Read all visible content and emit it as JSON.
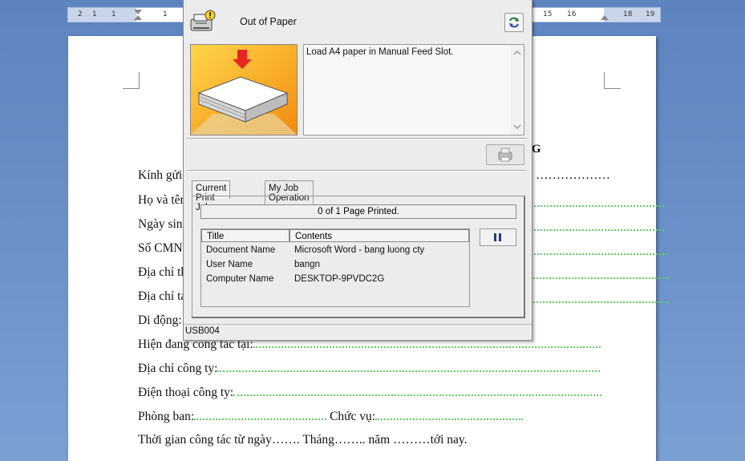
{
  "ruler": {
    "left_ticks": [
      "2",
      "1",
      "1",
      "1"
    ],
    "right_ticks": [
      "15",
      "16",
      "18",
      "19"
    ]
  },
  "document": {
    "heading_fragment": "NG",
    "lines": [
      {
        "label": "Kính gửi",
        "trailing": "………………"
      },
      {
        "label": "Họ và tên",
        "trailing": ""
      },
      {
        "label": "Ngày sin",
        "trailing": ""
      },
      {
        "label": "Số CMN",
        "trailing": ""
      },
      {
        "label": "Địa chỉ th",
        "trailing": ""
      },
      {
        "label": "Địa chỉ ta",
        "trailing": ""
      },
      {
        "label": "Di động:",
        "trailing": ""
      },
      {
        "label": "Hiện đang công tác tại:",
        "trailing": ""
      },
      {
        "label": "Địa chỉ công ty:",
        "trailing": ""
      },
      {
        "label": "Điện thoại công ty:",
        "trailing": ""
      }
    ],
    "phong_ban": "Phòng ban:",
    "chuc_vu": "Chức vụ:",
    "thoi_gian": {
      "prefix": "Thời gian công tác từ ngày",
      "d1": "…….",
      "thang": "Tháng",
      "d2": "……..",
      "nam": "năm",
      "d3": "………",
      "suffix": "tới nay."
    }
  },
  "dialog": {
    "title": "Out of Paper",
    "message": "Load A4 paper in Manual Feed Slot.",
    "tabs": [
      "Current Print Job",
      "My Job Operation"
    ],
    "progress_text": "0 of 1 Page Printed.",
    "columns": [
      "Title",
      "Contents"
    ],
    "rows": [
      {
        "title": "Document Name",
        "contents": "Microsoft Word - bang luong cty"
      },
      {
        "title": "User Name",
        "contents": "bangn"
      },
      {
        "title": "Computer Name",
        "contents": "DESKTOP-9PVDC2G"
      }
    ],
    "status": "USB004",
    "icons": {
      "printer": "printer-warning-icon",
      "refresh": "refresh-icon",
      "print": "printer-icon",
      "pause": "pause-icon"
    }
  },
  "colors": {
    "background": "#6a90c9",
    "illustration_orange": "#f7a21b",
    "arrow_red": "#e52621",
    "pause_blue": "#1d3a82"
  }
}
